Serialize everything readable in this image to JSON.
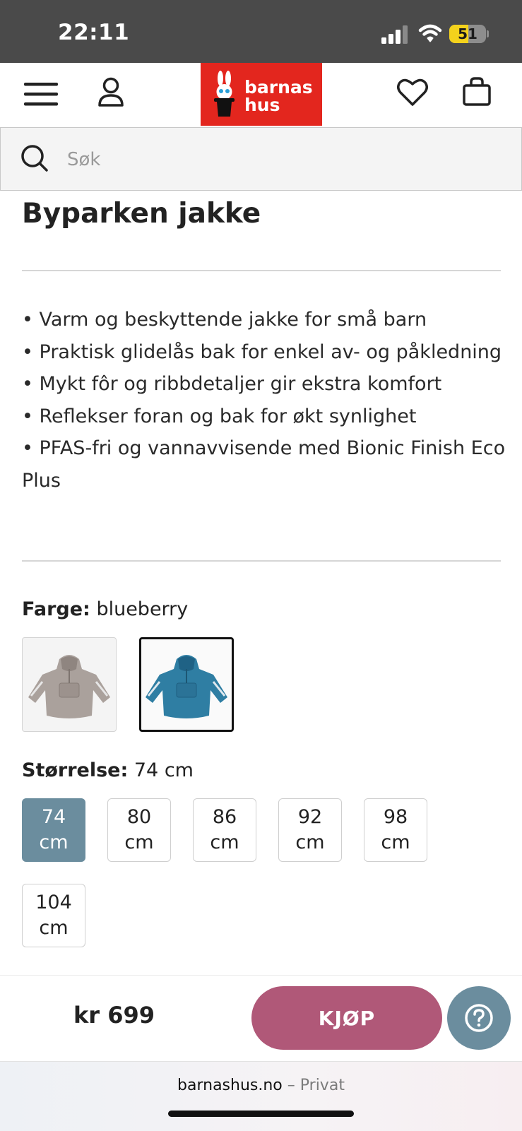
{
  "status_bar": {
    "time": "22:11",
    "battery": "51",
    "battery_fraction": 0.51,
    "icons": [
      "cellular-signal-icon",
      "wifi-icon",
      "battery-icon"
    ]
  },
  "header": {
    "icons": [
      "menu-icon",
      "user-icon",
      "heart-icon",
      "shopping-bag-icon"
    ],
    "logo": {
      "line1": "barnas",
      "line2": "hus",
      "color": "#e3261e"
    }
  },
  "search": {
    "placeholder": "Søk",
    "icon": "search-icon"
  },
  "product": {
    "title": "Byparken jakke",
    "bullets": [
      "• Varm og beskyttende jakke for små barn",
      "• Praktisk glidelås bak for enkel av- og påkledning",
      "• Mykt fôr og ribbdetaljer gir ekstra komfort",
      "• Reflekser foran og bak for økt synlighet",
      "• PFAS-fri og vannavvisende med Bionic Finish Eco Plus"
    ],
    "color": {
      "label": "Farge:",
      "value": "blueberry",
      "swatches": [
        {
          "name": "gray-jacket",
          "color": "#a9a09a",
          "selected": false
        },
        {
          "name": "blueberry-jacket",
          "color": "#2f7ea3",
          "selected": true
        }
      ]
    },
    "size": {
      "label": "Størrelse:",
      "value": "74 cm",
      "options": [
        "74 cm",
        "80 cm",
        "86 cm",
        "92 cm",
        "98 cm",
        "104 cm"
      ],
      "selected": "74 cm"
    }
  },
  "buy_bar": {
    "price": "kr 699",
    "buy_label": "KJØP",
    "buy_color": "#b05878",
    "help_icon": "question-mark-icon",
    "help_color": "#6b8d9e"
  },
  "browser": {
    "domain": "barnashus.no",
    "suffix": "– Privat"
  }
}
